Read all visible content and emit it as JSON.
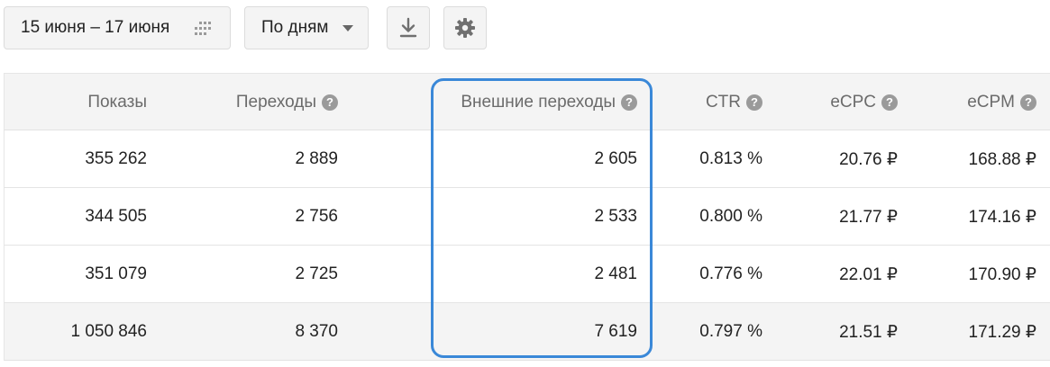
{
  "toolbar": {
    "date_range": "15 июня – 17 июня",
    "grouping": "По дням",
    "icons": {
      "calendar": "calendar-grid-icon",
      "dropdown": "chevron-down-icon",
      "download": "download-icon",
      "settings": "gear-icon"
    }
  },
  "table": {
    "columns": [
      {
        "label": "Показы",
        "help": false
      },
      {
        "label": "Переходы",
        "help": true
      },
      {
        "label": "Внешние переходы",
        "help": true
      },
      {
        "label": "CTR",
        "help": true
      },
      {
        "label": "eCPC",
        "help": true
      },
      {
        "label": "eCPM",
        "help": true
      }
    ],
    "help_glyph": "?",
    "rows": [
      [
        "355 262",
        "2 889",
        "2 605",
        "0.813 %",
        "20.76 ₽",
        "168.88 ₽"
      ],
      [
        "344 505",
        "2 756",
        "2 533",
        "0.800 %",
        "21.77 ₽",
        "174.16 ₽"
      ],
      [
        "351 079",
        "2 725",
        "2 481",
        "0.776 %",
        "22.01 ₽",
        "170.90 ₽"
      ]
    ],
    "total": [
      "1 050 846",
      "8 370",
      "7 619",
      "0.797 %",
      "21.51 ₽",
      "171.29 ₽"
    ]
  },
  "colors": {
    "highlight": "#3a88d8",
    "header_bg": "#f4f4f4",
    "help_icon": "#9a9a9a"
  }
}
